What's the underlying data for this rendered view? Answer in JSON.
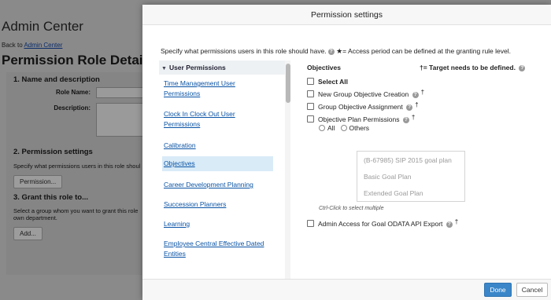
{
  "background": {
    "app_title": "Admin Center",
    "back_prefix": "Back to",
    "back_link": "Admin Center",
    "page_heading": "Permission Role Detail",
    "sections": {
      "name_desc": "1. Name and description",
      "role_name_label": "Role Name:",
      "description_label": "Description:",
      "perm_settings": "2. Permission settings",
      "perm_settings_text": "Specify what permissions users in this role shoul",
      "permission_button": "Permission...",
      "grant_role": "3. Grant this role to...",
      "grant_text_1": "Select a group whom you want to grant this role",
      "grant_text_2": "own department.",
      "add_button": "Add..."
    }
  },
  "dialog": {
    "title": "Permission settings",
    "intro": "Specify what permissions users in this role should have.",
    "intro_star": "★",
    "intro_access": "= Access period can be defined at the granting rule level.",
    "help_glyph": "?",
    "category_header": "User Permissions",
    "categories": [
      "Time Management User Permissions",
      "Clock In Clock Out User Permissions",
      "Calibration",
      "Objectives",
      "Career Development Planning",
      "Succession Planners",
      "Learning",
      "Employee Central Effective Dated Entities"
    ],
    "selected_category": "Objectives",
    "panel_title": "Objectives",
    "target_note": "†= Target needs to be defined.",
    "dagger": "†",
    "select_all": "Select All",
    "permissions": [
      "New Group Objective Creation",
      "Group Objective Assignment",
      "Objective Plan Permissions",
      "Admin Access for Goal ODATA API Export"
    ],
    "radio_all": "All",
    "radio_others": "Others",
    "plan_options": [
      "(B-67985) SIP 2015 goal plan",
      "Basic Goal Plan",
      "Extended Goal Plan"
    ],
    "ctrl_hint": "Ctrl-Click to select multiple",
    "done_label": "Done",
    "cancel_label": "Cancel"
  }
}
